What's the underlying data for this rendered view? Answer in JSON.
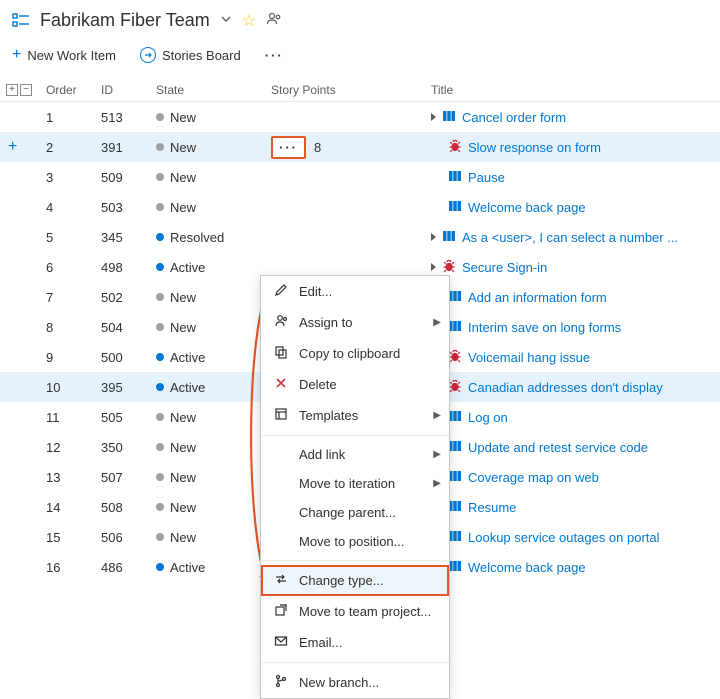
{
  "header": {
    "team_name": "Fabrikam Fiber Team"
  },
  "toolbar": {
    "new_work_item": "New Work Item",
    "stories_board": "Stories Board"
  },
  "columns": {
    "order": "Order",
    "id": "ID",
    "state": "State",
    "story_points": "Story Points",
    "title": "Title"
  },
  "state_labels": {
    "new": "New",
    "resolved": "Resolved",
    "active": "Active"
  },
  "rows": [
    {
      "order": 1,
      "id": 513,
      "state": "new",
      "sp": "",
      "expand": true,
      "type": "story",
      "title": "Cancel order form"
    },
    {
      "order": 2,
      "id": 391,
      "state": "new",
      "sp": "8",
      "expand": false,
      "type": "bug",
      "title": "Slow response on form",
      "selected": true
    },
    {
      "order": 3,
      "id": 509,
      "state": "new",
      "sp": "",
      "expand": false,
      "type": "story",
      "title": "Pause"
    },
    {
      "order": 4,
      "id": 503,
      "state": "new",
      "sp": "",
      "expand": false,
      "type": "story",
      "title": "Welcome back page"
    },
    {
      "order": 5,
      "id": 345,
      "state": "resolved",
      "sp": "",
      "expand": true,
      "type": "story",
      "title": "As a <user>, I can select a number ..."
    },
    {
      "order": 6,
      "id": 498,
      "state": "active",
      "sp": "",
      "expand": true,
      "type": "bug",
      "title": "Secure Sign-in"
    },
    {
      "order": 7,
      "id": 502,
      "state": "new",
      "sp": "",
      "expand": false,
      "type": "story",
      "title": "Add an information form"
    },
    {
      "order": 8,
      "id": 504,
      "state": "new",
      "sp": "",
      "expand": false,
      "type": "story",
      "title": "Interim save on long forms"
    },
    {
      "order": 9,
      "id": 500,
      "state": "active",
      "sp": "",
      "expand": false,
      "type": "bug",
      "title": "Voicemail hang issue"
    },
    {
      "order": 10,
      "id": 395,
      "state": "active",
      "sp": "",
      "expand": false,
      "type": "bug",
      "title": "Canadian addresses don't display",
      "selected": true
    },
    {
      "order": 11,
      "id": 505,
      "state": "new",
      "sp": "",
      "expand": false,
      "type": "story",
      "title": "Log on"
    },
    {
      "order": 12,
      "id": 350,
      "state": "new",
      "sp": "",
      "expand": false,
      "type": "story",
      "title": "Update and retest service code"
    },
    {
      "order": 13,
      "id": 507,
      "state": "new",
      "sp": "",
      "expand": false,
      "type": "story",
      "title": "Coverage map on web"
    },
    {
      "order": 14,
      "id": 508,
      "state": "new",
      "sp": "",
      "expand": false,
      "type": "story",
      "title": "Resume"
    },
    {
      "order": 15,
      "id": 506,
      "state": "new",
      "sp": "",
      "expand": false,
      "type": "story",
      "title": "Lookup service outages on portal"
    },
    {
      "order": 16,
      "id": 486,
      "state": "active",
      "sp": "",
      "expand": false,
      "type": "story",
      "title": "Welcome back page"
    }
  ],
  "menu": {
    "edit": "Edit...",
    "assign_to": "Assign to",
    "copy": "Copy to clipboard",
    "delete": "Delete",
    "templates": "Templates",
    "add_link": "Add link",
    "move_iteration": "Move to iteration",
    "change_parent": "Change parent...",
    "move_position": "Move to position...",
    "change_type": "Change type...",
    "move_team_project": "Move to team project...",
    "email": "Email...",
    "new_branch": "New branch..."
  }
}
